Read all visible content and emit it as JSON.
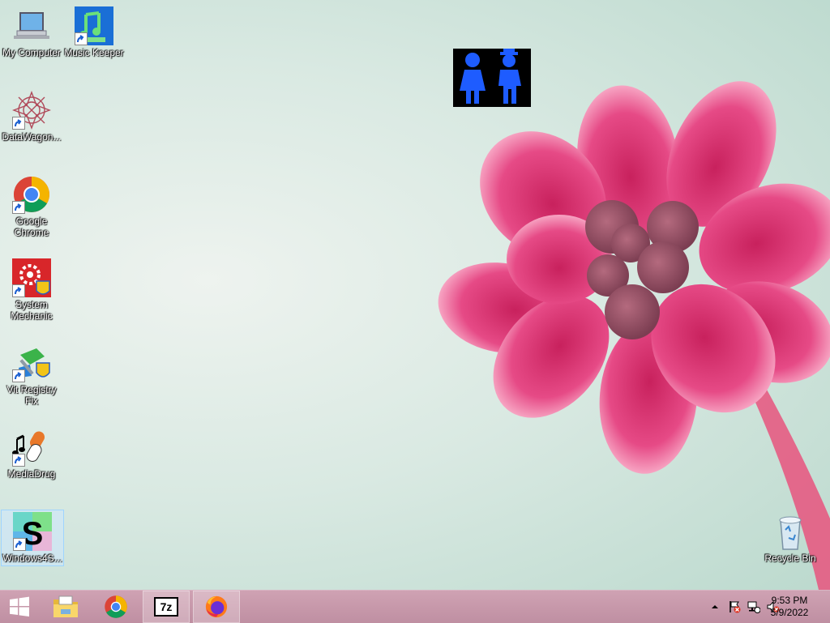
{
  "desktop_icons": [
    {
      "label": "My Computer",
      "icon": "computer-icon"
    },
    {
      "label": "Music Keeper",
      "icon": "music-keeper-icon"
    },
    {
      "label": "DataWagon...",
      "icon": "datawagon-icon"
    },
    {
      "label": "Google Chrome",
      "icon": "chrome-icon"
    },
    {
      "label": "System Mechanic",
      "icon": "system-mechanic-icon"
    },
    {
      "label": "Vit Registry Fix",
      "icon": "vit-registry-fix-icon"
    },
    {
      "label": "MediaDrug",
      "icon": "mediadrug-icon"
    },
    {
      "label": "Windows4S...",
      "icon": "windows4s-icon"
    },
    {
      "label": "Recycle Bin",
      "icon": "recycle-bin-icon"
    }
  ],
  "floating_widget": {
    "icon": "parents-kids-icon"
  },
  "taskbar": {
    "start": {
      "icon": "windows-start-icon"
    },
    "pinned": [
      {
        "icon": "file-explorer-icon"
      },
      {
        "icon": "chrome-icon"
      },
      {
        "icon": "7zip-icon",
        "text": "7z"
      },
      {
        "icon": "firefox-icon"
      }
    ],
    "tray": {
      "icons": [
        "show-hidden-icons-chevron-icon",
        "action-center-flag-icon",
        "network-icon",
        "volume-muted-icon"
      ],
      "time": "9:53 PM",
      "date": "5/9/2022"
    }
  },
  "colors": {
    "taskbar": "#c596a9",
    "flower": "#e0437f",
    "background": "#d9e9e2"
  }
}
